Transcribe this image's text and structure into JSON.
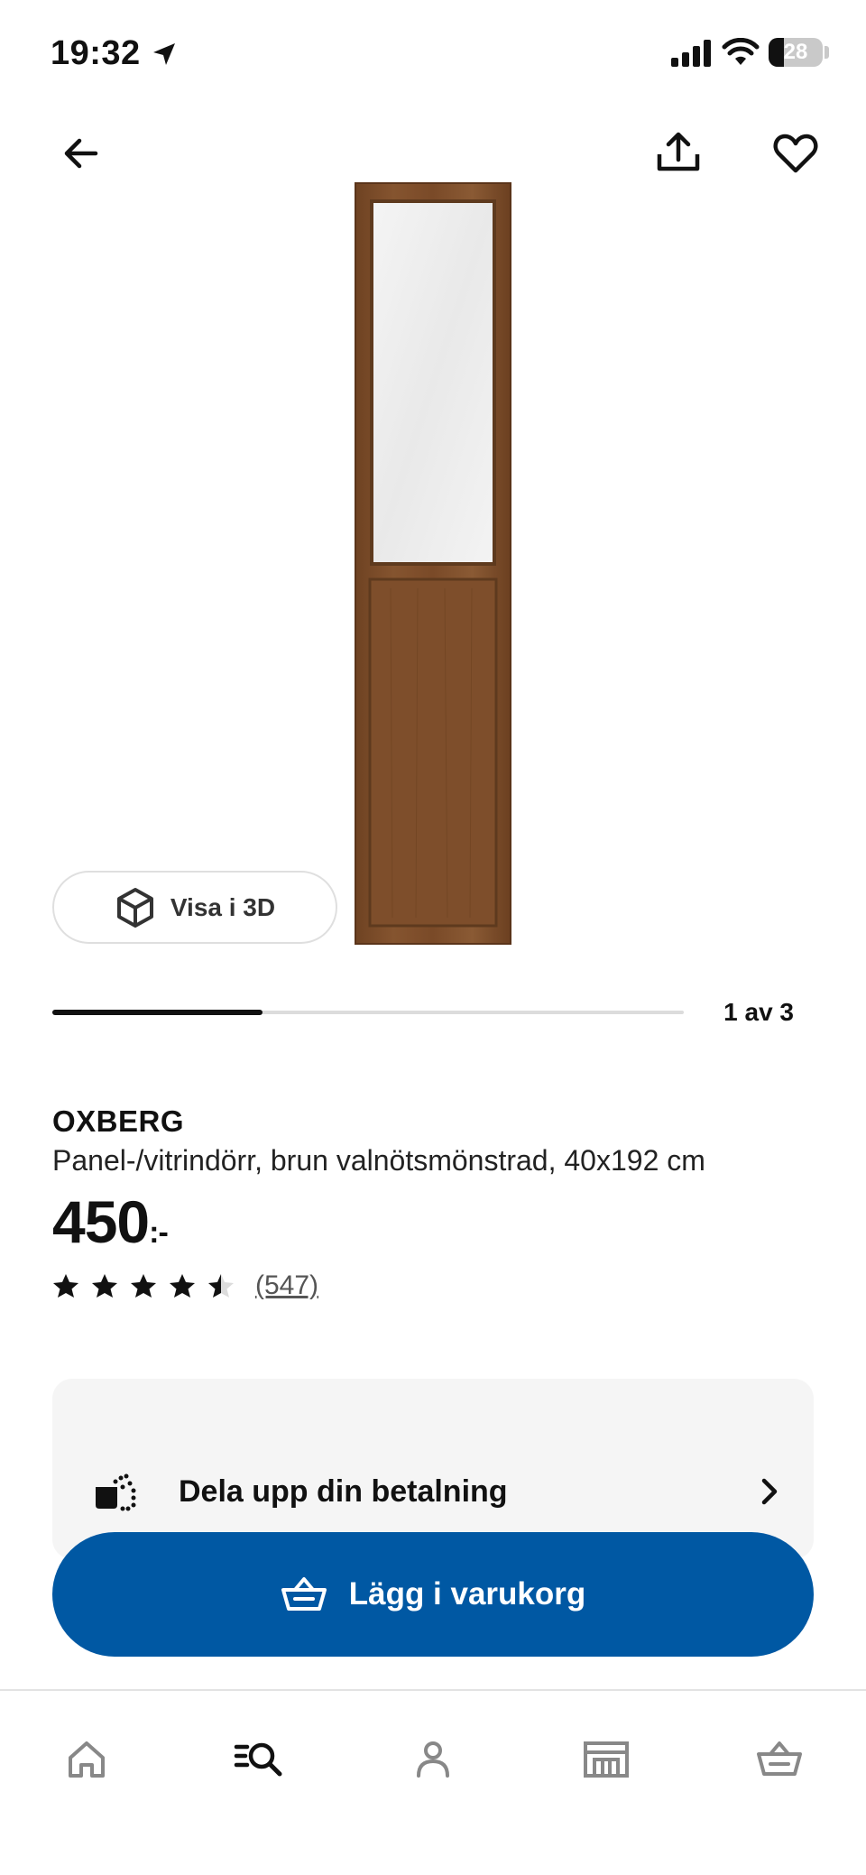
{
  "status_bar": {
    "time": "19:32",
    "battery_level": "28",
    "battery_fraction": 0.28,
    "icons": [
      "location-arrow-icon",
      "signal-icon",
      "wifi-icon",
      "battery-icon"
    ]
  },
  "header": {
    "icons": [
      "back-arrow-icon",
      "share-icon",
      "heart-icon"
    ]
  },
  "gallery": {
    "view_3d_label": "Visa i 3D",
    "view_3d_icon": "cube-icon",
    "counter": "1 av 3",
    "current_image": 1,
    "total_images": 3
  },
  "product": {
    "name": "OXBERG",
    "description": "Panel-/vitrindörr, brun valnötsmönstrad, 40x192 cm",
    "price": "450",
    "price_suffix": ":-",
    "rating": 4.5,
    "rating_max": 5,
    "review_count": "(547)"
  },
  "payment": {
    "label": "Dela upp din betalning",
    "icon": "split-payment-icon"
  },
  "cart_button": {
    "label": "Lägg i varukorg",
    "icon": "basket-icon"
  },
  "tabbar": {
    "items": [
      "home-icon",
      "search-icon",
      "profile-icon",
      "store-icon",
      "cart-icon"
    ],
    "active": "search-icon"
  },
  "colors": {
    "brand_blue": "#0058a3",
    "wood": "#7a4a28",
    "card_bg": "#f5f5f5"
  }
}
